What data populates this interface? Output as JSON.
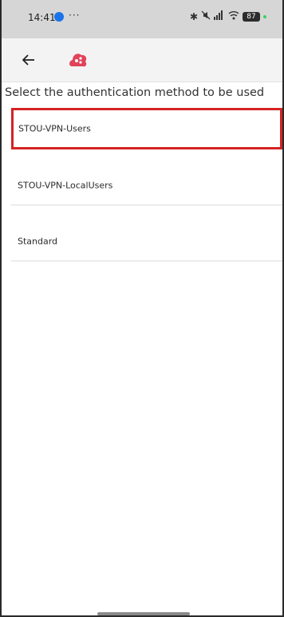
{
  "status_bar": {
    "time": "14:41",
    "overflow_dots": "···",
    "battery_level": "87"
  },
  "app_bar": {
    "back_icon": "arrow-left-icon",
    "logo_icon": "cloud-app-logo"
  },
  "prompt": "Select the authentication method to be used",
  "options": [
    {
      "label": "STOU-VPN-Users",
      "selected": true
    },
    {
      "label": "STOU-VPN-LocalUsers",
      "selected": false
    },
    {
      "label": "Standard",
      "selected": false
    }
  ],
  "colors": {
    "selection_border": "#d42323",
    "logo_primary": "#e0435a"
  }
}
